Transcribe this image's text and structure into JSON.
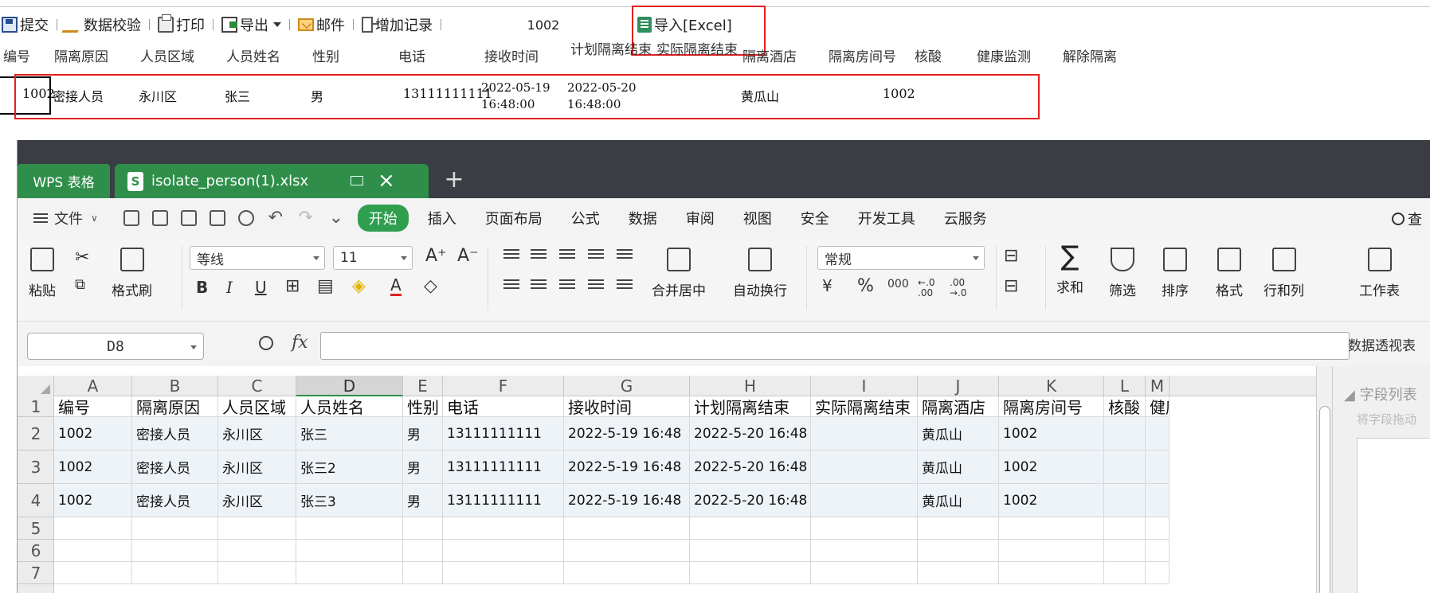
{
  "toolbar": {
    "submit": "提交",
    "validate": "数据校验",
    "print": "打印",
    "export": "导出",
    "mail": "邮件",
    "add_record": "增加记录",
    "value": "1002",
    "import_excel": "导入[Excel]"
  },
  "form": {
    "headers": [
      "编号",
      "隔离原因",
      "人员区域",
      "人员姓名",
      "性别",
      "电话",
      "接收时间",
      "计划隔离结束",
      "实际隔离结束",
      "隔离酒店",
      "隔离房间号",
      "核酸",
      "健康监测",
      "解除隔离"
    ],
    "row": {
      "id": "1002",
      "reason": "密接人员",
      "area": "永川区",
      "name": "张三",
      "gender": "男",
      "phone": "13111111111",
      "receive_date": "2022-05-19",
      "receive_time": "16:48:00",
      "plan_end_date": "2022-05-20",
      "plan_end_time": "16:48:00",
      "hotel": "黄瓜山",
      "room": "1002"
    }
  },
  "wps": {
    "app_tab": "WPS 表格",
    "file_tab": "isolate_person(1).xlsx",
    "file_badge": "S",
    "new_tab": "+",
    "menu_file": "文件",
    "menu_tabs": [
      "开始",
      "插入",
      "页面布局",
      "公式",
      "数据",
      "审阅",
      "视图",
      "安全",
      "开发工具",
      "云服务"
    ],
    "search": "查",
    "ribbon": {
      "paste": "粘贴",
      "format_painter": "格式刷",
      "font_name": "等线",
      "font_size": "11",
      "merge_center": "合并居中",
      "wrap_text": "自动换行",
      "number_format": "常规",
      "sum": "求和",
      "filter": "筛选",
      "sort": "排序",
      "format": "格式",
      "row_col": "行和列",
      "worksheet": "工作表",
      "bold": "B",
      "italic": "I",
      "underline": "U",
      "font_color": "A",
      "grow_font": "A⁺",
      "shrink_font": "A⁻",
      "percent": "%",
      "currency": "¥",
      "thousands": "000",
      "inc_decimal": "←.0 .00",
      "dec_decimal": ".00 →.0"
    },
    "name_box": "D8",
    "fx": "fx",
    "pivot": "数据透视表",
    "field_list": "◢ 字段列表",
    "field_hint": "将字段拖动",
    "columns": [
      "A",
      "B",
      "C",
      "D",
      "E",
      "F",
      "G",
      "H",
      "I",
      "J",
      "K",
      "L",
      "M"
    ],
    "rows": [
      "1",
      "2",
      "3",
      "4",
      "5",
      "6",
      "7"
    ],
    "sheet_header": [
      "编号",
      "隔离原因",
      "人员区域",
      "人员姓名",
      "性别",
      "电话",
      "接收时间",
      "计划隔离结束",
      "实际隔离结束",
      "隔离酒店",
      "隔离房间号",
      "核酸",
      "健康"
    ],
    "sheet_rows": [
      [
        "1002",
        "密接人员",
        "永川区",
        "张三",
        "男",
        "13111111111",
        "2022-5-19 16:48",
        "2022-5-20 16:48",
        "",
        "黄瓜山",
        "1002",
        "",
        ""
      ],
      [
        "1002",
        "密接人员",
        "永川区",
        "张三2",
        "男",
        "13111111111",
        "2022-5-19 16:48",
        "2022-5-20 16:48",
        "",
        "黄瓜山",
        "1002",
        "",
        ""
      ],
      [
        "1002",
        "密接人员",
        "永川区",
        "张三3",
        "男",
        "13111111111",
        "2022-5-19 16:48",
        "2022-5-20 16:48",
        "",
        "黄瓜山",
        "1002",
        "",
        ""
      ]
    ]
  }
}
